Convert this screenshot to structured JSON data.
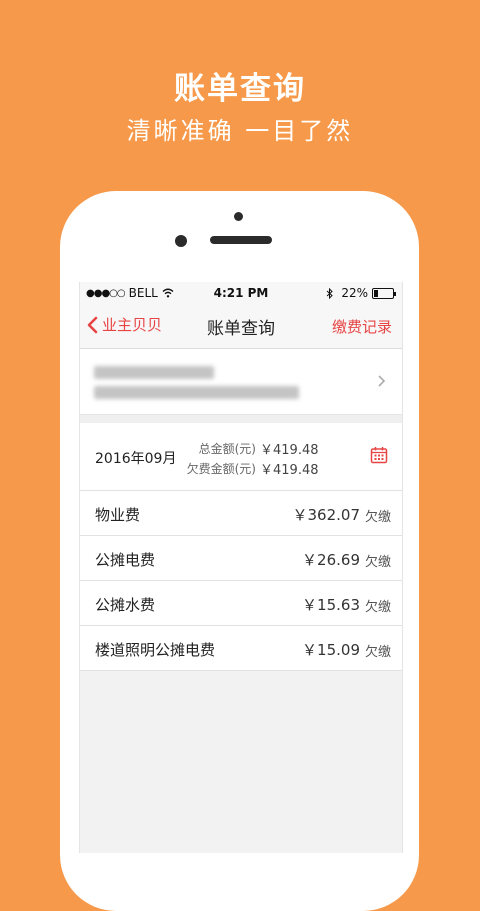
{
  "promo": {
    "title": "账单查询",
    "subtitle": "清晰准确 一目了然"
  },
  "status_bar": {
    "carrier": "BELL",
    "signal_dots": "●●●○○",
    "time": "4:21 PM",
    "battery_percent": "22%",
    "battery_level": 0.22
  },
  "nav": {
    "back_label": "业主贝贝",
    "title": "账单查询",
    "right_label": "缴费记录"
  },
  "summary": {
    "month": "2016年09月",
    "total_label": "总金额(元)",
    "total_value": "￥419.48",
    "owed_label": "欠费金额(元)",
    "owed_value": "￥419.48"
  },
  "bills": [
    {
      "name": "物业费",
      "amount": "￥362.07",
      "status": "欠缴"
    },
    {
      "name": "公摊电费",
      "amount": "￥26.69",
      "status": "欠缴"
    },
    {
      "name": "公摊水费",
      "amount": "￥15.63",
      "status": "欠缴"
    },
    {
      "name": "楼道照明公摊电费",
      "amount": "￥15.09",
      "status": "欠缴"
    }
  ],
  "colors": {
    "background": "#F6994A",
    "accent": "#E84444"
  },
  "icons": [
    "wifi-icon",
    "bluetooth-icon",
    "battery-icon",
    "back-chevron-icon",
    "chevron-right-icon",
    "calendar-icon"
  ]
}
